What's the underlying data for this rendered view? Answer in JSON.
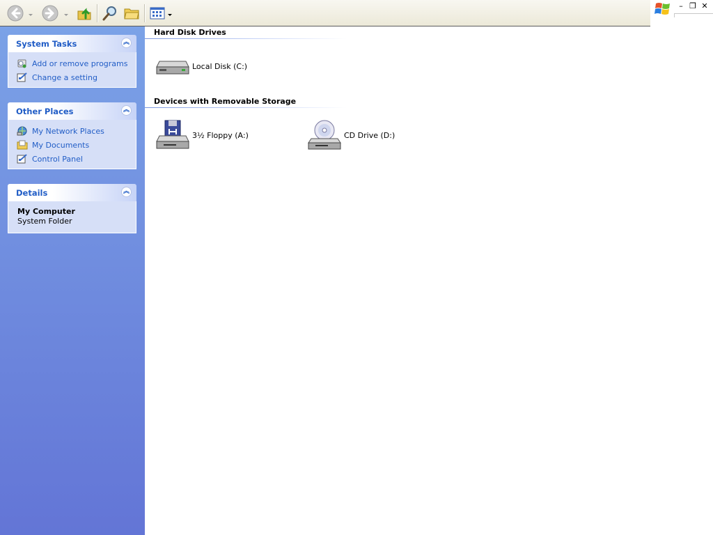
{
  "toolbar": {
    "back": "back-icon",
    "forward": "forward-icon",
    "up": "up-folder-icon",
    "search": "search-icon",
    "folders": "folders-icon",
    "views": "views-icon"
  },
  "window_controls": {
    "minimize": "–",
    "restore": "❐",
    "close": "✕"
  },
  "task_pane": {
    "system_tasks": {
      "title": "System Tasks",
      "items": [
        {
          "label": "Add or remove programs",
          "icon": "add-remove-programs-icon"
        },
        {
          "label": "Change a setting",
          "icon": "control-panel-setting-icon"
        }
      ]
    },
    "other_places": {
      "title": "Other Places",
      "items": [
        {
          "label": "My Network Places",
          "icon": "network-places-icon"
        },
        {
          "label": "My Documents",
          "icon": "my-documents-icon"
        },
        {
          "label": "Control Panel",
          "icon": "control-panel-icon"
        }
      ]
    },
    "details": {
      "title": "Details",
      "name": "My Computer",
      "type": "System Folder"
    },
    "collapse_glyph": "︽"
  },
  "content": {
    "groups": [
      {
        "title": "Hard Disk Drives",
        "items": [
          {
            "label": "Local Disk (C:)",
            "icon": "hard-disk-icon"
          }
        ]
      },
      {
        "title": "Devices with Removable Storage",
        "items": [
          {
            "label": "3½ Floppy (A:)",
            "icon": "floppy-drive-icon"
          },
          {
            "label": "CD Drive (D:)",
            "icon": "cd-drive-icon"
          }
        ]
      }
    ]
  },
  "colors": {
    "taskpane_top": "#7ba2e7",
    "taskpane_bottom": "#6375d6",
    "link": "#215dc6",
    "panel_body": "#d6dff7"
  }
}
